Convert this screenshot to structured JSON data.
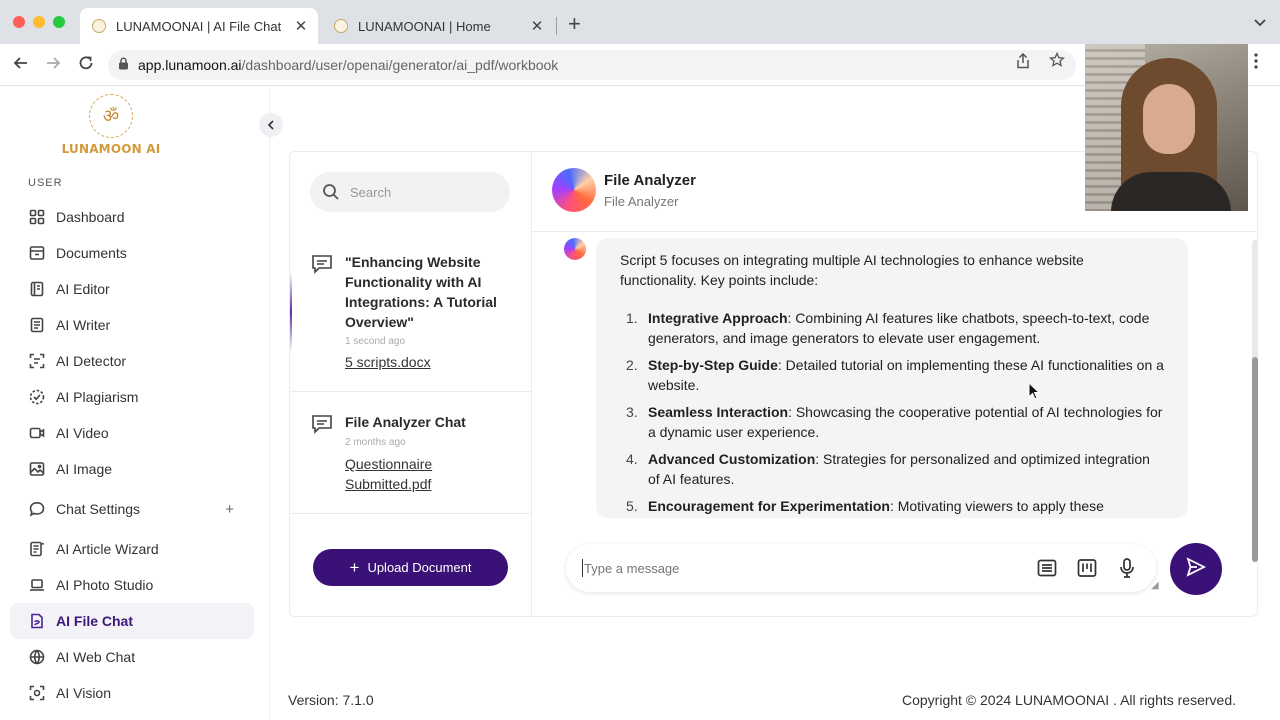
{
  "browser": {
    "tabs": [
      {
        "title": "LUNAMOONAI | AI File Chat",
        "active": true
      },
      {
        "title": "LUNAMOONAI | Home",
        "active": false
      }
    ],
    "close_glyph": "✕",
    "new_tab_glyph": "+",
    "url_host": "app.lunamoon.ai",
    "url_path": "/dashboard/user/openai/generator/ai_pdf/workbook"
  },
  "sidebar": {
    "logo_text": "LUNAMOON AI",
    "section_label": "USER",
    "items": [
      {
        "label": "Dashboard",
        "icon": "dashboard-icon"
      },
      {
        "label": "Documents",
        "icon": "documents-icon"
      },
      {
        "label": "AI Editor",
        "icon": "editor-icon"
      },
      {
        "label": "AI Writer",
        "icon": "writer-icon"
      },
      {
        "label": "AI Detector",
        "icon": "detector-icon"
      },
      {
        "label": "AI Plagiarism",
        "icon": "plagiarism-icon"
      },
      {
        "label": "AI Video",
        "icon": "video-icon"
      },
      {
        "label": "AI Image",
        "icon": "image-icon"
      },
      {
        "label": "Chat Settings",
        "icon": "chat-icon",
        "expandable": true
      },
      {
        "label": "AI Article Wizard",
        "icon": "wizard-icon"
      },
      {
        "label": "AI Photo Studio",
        "icon": "laptop-icon"
      },
      {
        "label": "AI File Chat",
        "icon": "file-chat-icon",
        "active": true
      },
      {
        "label": "AI Web Chat",
        "icon": "globe-icon"
      },
      {
        "label": "AI Vision",
        "icon": "scan-icon"
      }
    ],
    "plus_glyph": "+"
  },
  "conversations": {
    "search_placeholder": "Search",
    "items": [
      {
        "title": "\"Enhancing Website Functionality with AI Integrations: A Tutorial Overview\"",
        "time": "1 second ago",
        "file": "5 scripts.docx"
      },
      {
        "title": "File Analyzer Chat",
        "time": "2 months ago",
        "file": "Questionnaire Submitted.pdf"
      }
    ],
    "upload_label": "Upload Document"
  },
  "chat": {
    "name": "File Analyzer",
    "subtitle": "File Analyzer",
    "message_intro": "Script 5 focuses on integrating multiple AI technologies to enhance website functionality. Key points include:",
    "points": [
      {
        "num": "1.",
        "term": "Integrative Approach",
        "text": ": Combining AI features like chatbots, speech-to-text, code generators, and image generators to elevate user engagement."
      },
      {
        "num": "2.",
        "term": "Step-by-Step Guide",
        "text": ": Detailed tutorial on implementing these AI functionalities on a website."
      },
      {
        "num": "3.",
        "term": "Seamless Interaction",
        "text": ": Showcasing the cooperative potential of AI technologies for a dynamic user experience."
      },
      {
        "num": "4.",
        "term": "Advanced Customization",
        "text": ": Strategies for personalized and optimized integration of AI features."
      },
      {
        "num": "5.",
        "term": "Encouragement for Experimentation",
        "text": ": Motivating viewers to apply these"
      }
    ],
    "input_placeholder": "Type a message"
  },
  "footer": {
    "version": "Version: 7.1.0",
    "copyright": "Copyright © 2024 LUNAMOONAI . All rights reserved."
  },
  "colors": {
    "accent": "#3a1177",
    "active_nav_text": "#3c1779",
    "logo_gold": "#d29a3b"
  }
}
